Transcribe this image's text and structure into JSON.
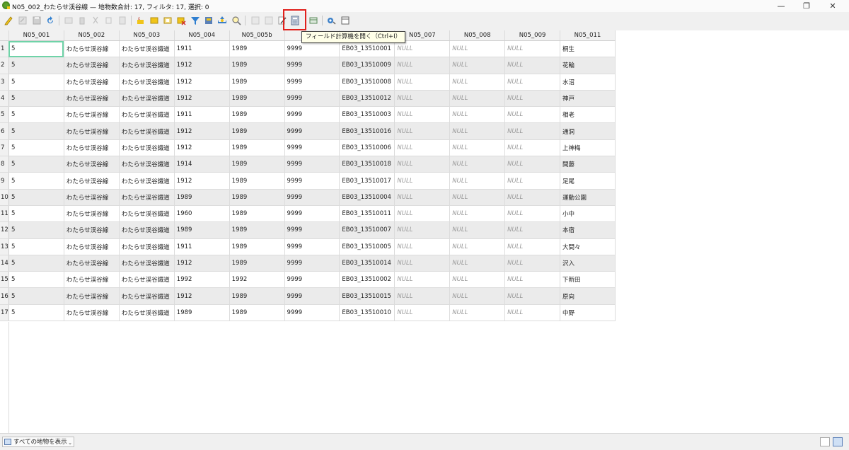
{
  "window": {
    "title": "N05_002_わたらせ渓谷線 — 地物数合計: 17, フィルタ: 17, 選択: 0",
    "minimize": "—",
    "restore": "❐",
    "close": "✕"
  },
  "tooltip": "フィールド計算機を開く（Ctrl+I）",
  "columns": [
    "N05_001",
    "N05_002",
    "N05_003",
    "N05_004",
    "N05_005b",
    "N",
    "",
    "N05_007",
    "N05_008",
    "N05_009",
    "N05_011"
  ],
  "rows": [
    {
      "n": "1",
      "c": [
        "5",
        "わたらせ渓谷線",
        "わたらせ渓谷鐵道",
        "1911",
        "1989",
        "9999",
        "EB03_13510001",
        "NULL",
        "NULL",
        "NULL",
        "桐生"
      ]
    },
    {
      "n": "2",
      "c": [
        "5",
        "わたらせ渓谷線",
        "わたらせ渓谷鐵道",
        "1912",
        "1989",
        "9999",
        "EB03_13510009",
        "NULL",
        "NULL",
        "NULL",
        "花輪"
      ]
    },
    {
      "n": "3",
      "c": [
        "5",
        "わたらせ渓谷線",
        "わたらせ渓谷鐵道",
        "1912",
        "1989",
        "9999",
        "EB03_13510008",
        "NULL",
        "NULL",
        "NULL",
        "水沼"
      ]
    },
    {
      "n": "4",
      "c": [
        "5",
        "わたらせ渓谷線",
        "わたらせ渓谷鐵道",
        "1912",
        "1989",
        "9999",
        "EB03_13510012",
        "NULL",
        "NULL",
        "NULL",
        "神戸"
      ]
    },
    {
      "n": "5",
      "c": [
        "5",
        "わたらせ渓谷線",
        "わたらせ渓谷鐵道",
        "1911",
        "1989",
        "9999",
        "EB03_13510003",
        "NULL",
        "NULL",
        "NULL",
        "相老"
      ]
    },
    {
      "n": "6",
      "c": [
        "5",
        "わたらせ渓谷線",
        "わたらせ渓谷鐵道",
        "1912",
        "1989",
        "9999",
        "EB03_13510016",
        "NULL",
        "NULL",
        "NULL",
        "通洞"
      ]
    },
    {
      "n": "7",
      "c": [
        "5",
        "わたらせ渓谷線",
        "わたらせ渓谷鐵道",
        "1912",
        "1989",
        "9999",
        "EB03_13510006",
        "NULL",
        "NULL",
        "NULL",
        "上神梅"
      ]
    },
    {
      "n": "8",
      "c": [
        "5",
        "わたらせ渓谷線",
        "わたらせ渓谷鐵道",
        "1914",
        "1989",
        "9999",
        "EB03_13510018",
        "NULL",
        "NULL",
        "NULL",
        "間藤"
      ]
    },
    {
      "n": "9",
      "c": [
        "5",
        "わたらせ渓谷線",
        "わたらせ渓谷鐵道",
        "1912",
        "1989",
        "9999",
        "EB03_13510017",
        "NULL",
        "NULL",
        "NULL",
        "足尾"
      ]
    },
    {
      "n": "10",
      "c": [
        "5",
        "わたらせ渓谷線",
        "わたらせ渓谷鐵道",
        "1989",
        "1989",
        "9999",
        "EB03_13510004",
        "NULL",
        "NULL",
        "NULL",
        "運動公園"
      ]
    },
    {
      "n": "11",
      "c": [
        "5",
        "わたらせ渓谷線",
        "わたらせ渓谷鐵道",
        "1960",
        "1989",
        "9999",
        "EB03_13510011",
        "NULL",
        "NULL",
        "NULL",
        "小中"
      ]
    },
    {
      "n": "12",
      "c": [
        "5",
        "わたらせ渓谷線",
        "わたらせ渓谷鐵道",
        "1989",
        "1989",
        "9999",
        "EB03_13510007",
        "NULL",
        "NULL",
        "NULL",
        "本宿"
      ]
    },
    {
      "n": "13",
      "c": [
        "5",
        "わたらせ渓谷線",
        "わたらせ渓谷鐵道",
        "1911",
        "1989",
        "9999",
        "EB03_13510005",
        "NULL",
        "NULL",
        "NULL",
        "大間々"
      ]
    },
    {
      "n": "14",
      "c": [
        "5",
        "わたらせ渓谷線",
        "わたらせ渓谷鐵道",
        "1912",
        "1989",
        "9999",
        "EB03_13510014",
        "NULL",
        "NULL",
        "NULL",
        "沢入"
      ]
    },
    {
      "n": "15",
      "c": [
        "5",
        "わたらせ渓谷線",
        "わたらせ渓谷鐵道",
        "1992",
        "1992",
        "9999",
        "EB03_13510002",
        "NULL",
        "NULL",
        "NULL",
        "下新田"
      ]
    },
    {
      "n": "16",
      "c": [
        "5",
        "わたらせ渓谷線",
        "わたらせ渓谷鐵道",
        "1912",
        "1989",
        "9999",
        "EB03_13510015",
        "NULL",
        "NULL",
        "NULL",
        "原向"
      ]
    },
    {
      "n": "17",
      "c": [
        "5",
        "わたらせ渓谷線",
        "わたらせ渓谷鐵道",
        "1989",
        "1989",
        "9999",
        "EB03_13510010",
        "NULL",
        "NULL",
        "NULL",
        "中野"
      ]
    }
  ],
  "statusbar": {
    "filter_label": "すべての地物を表示"
  },
  "colors": {
    "highlight": "#e0201c",
    "selected_cell": "#6fd3a8",
    "alt_row": "#ebebeb"
  }
}
